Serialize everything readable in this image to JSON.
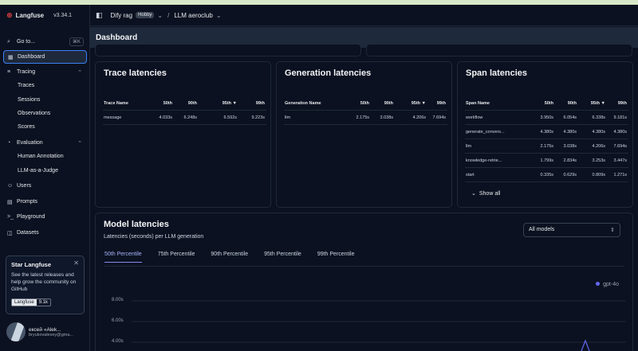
{
  "app": {
    "name": "Langfuse",
    "version": "v3.34.1"
  },
  "sidebar": {
    "goto": {
      "label": "Go to...",
      "shortcut": "⌘K"
    },
    "items": [
      {
        "label": "Dashboard",
        "icon": "dashboard-icon"
      },
      {
        "label": "Tracing",
        "icon": "tracing-icon"
      },
      {
        "label": "Traces"
      },
      {
        "label": "Sessions"
      },
      {
        "label": "Observations"
      },
      {
        "label": "Scores"
      },
      {
        "label": "Evaluation",
        "icon": "evaluation-icon"
      },
      {
        "label": "Human Annotation"
      },
      {
        "label": "LLM-as-a-Judge"
      },
      {
        "label": "Users",
        "icon": "users-icon"
      },
      {
        "label": "Prompts",
        "icon": "prompts-icon"
      },
      {
        "label": "Playground",
        "icon": "terminal-icon"
      },
      {
        "label": "Datasets",
        "icon": "database-icon"
      }
    ],
    "star": {
      "title": "Star Langfuse",
      "desc": "See the latest releases and help grow the community on GitHub",
      "gh_label": "Langfuse",
      "gh_count": "9.1k"
    },
    "user": {
      "name": "ексей «Alek...",
      "email": "bryukovalexey@gma..."
    }
  },
  "topbar": {
    "project": "Dify rag",
    "plan": "Hobby",
    "sep": "/",
    "env": "LLM aeroclub"
  },
  "page_title": "Dashboard",
  "trace": {
    "title": "Trace latencies",
    "headers": [
      "Trace Name",
      "50th",
      "90th",
      "95th ▼",
      "99th"
    ],
    "rows": [
      [
        "message",
        "4.033s",
        "6.248s",
        "6.592s",
        "9.223s"
      ]
    ]
  },
  "generation": {
    "title": "Generation latencies",
    "headers": [
      "Generation Name",
      "50th",
      "90th",
      "95th ▼",
      "99th"
    ],
    "rows": [
      [
        "llm",
        "2.175s",
        "3.038s",
        "4.206s",
        "7.694s"
      ]
    ]
  },
  "span": {
    "title": "Span latencies",
    "headers": [
      "Span Name",
      "50th",
      "90th",
      "95th ▼",
      "99th"
    ],
    "rows": [
      [
        "workflow",
        "3.950s",
        "6.054s",
        "6.338s",
        "9.181s"
      ],
      [
        "generate_convers...",
        "4.380s",
        "4.380s",
        "4.380s",
        "4.380s"
      ],
      [
        "llm",
        "2.175s",
        "3.038s",
        "4.206s",
        "7.694s"
      ],
      [
        "knowledge-retrie...",
        "1.799s",
        "2.834s",
        "3.253s",
        "3.447s"
      ],
      [
        "start",
        "0.335s",
        "0.629s",
        "0.809s",
        "1.271s"
      ]
    ],
    "show_all": "Show all"
  },
  "model": {
    "title": "Model latencies",
    "subtitle": "Latencies (seconds) per LLM generation",
    "select": "All models",
    "tabs": [
      "50th Percentile",
      "75th Percentile",
      "90th Percentile",
      "95th Percentile",
      "99th Percentile"
    ],
    "legend": "gpt-4o",
    "yticks": [
      "8.00s",
      "6.00s",
      "4.00s"
    ]
  },
  "colors": {
    "accent": "#818cf8",
    "series": "#6366f1",
    "active_border": "#3b82f6"
  }
}
